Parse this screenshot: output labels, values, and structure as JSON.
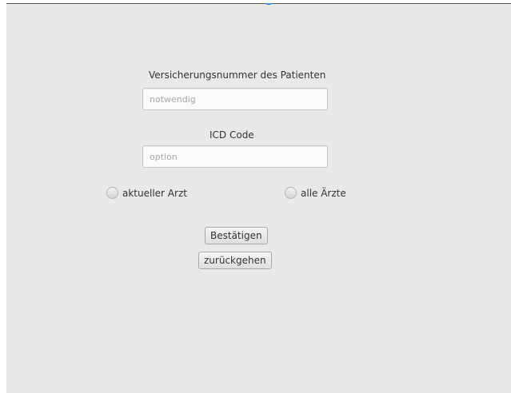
{
  "form": {
    "insurance_number": {
      "label": "Versicherungsnummer des Patienten",
      "placeholder": "notwendig",
      "value": ""
    },
    "icd_code": {
      "label": "ICD Code",
      "placeholder": "option",
      "value": ""
    },
    "radio_options": [
      {
        "label": "aktueller Arzt",
        "selected": false
      },
      {
        "label": "alle Ärzte",
        "selected": false
      }
    ],
    "confirm_label": "Bestätigen",
    "back_label": "zurückgehen"
  },
  "colors": {
    "background": "#e9e9e9",
    "accent": "#3a8ee6"
  }
}
